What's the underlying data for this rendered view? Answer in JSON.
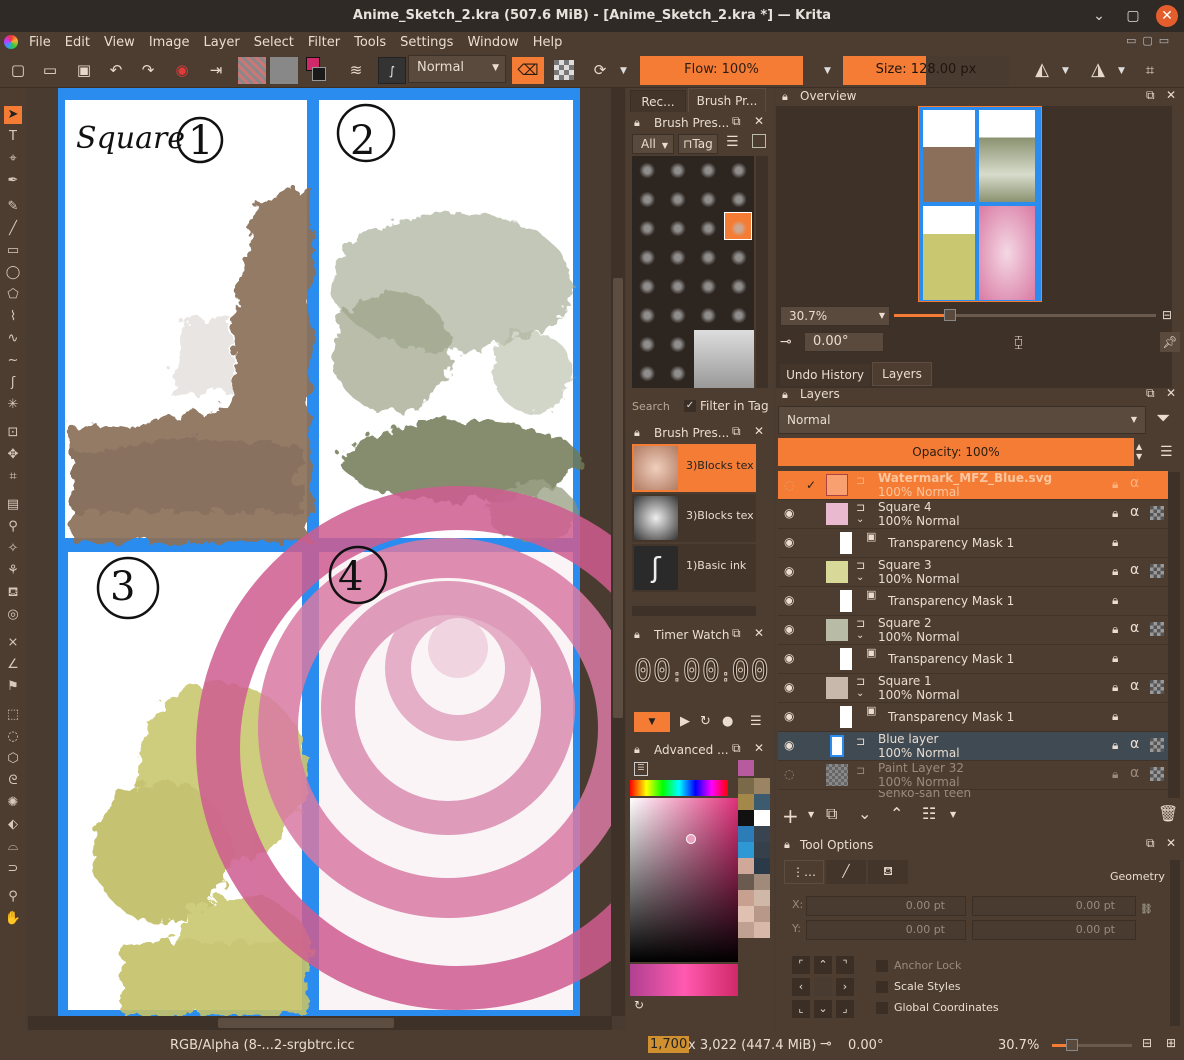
{
  "window": {
    "title": "Anime_Sketch_2.kra (507.6 MiB)  - [Anime_Sketch_2.kra *] — Krita"
  },
  "menu": [
    "File",
    "Edit",
    "View",
    "Image",
    "Layer",
    "Select",
    "Filter",
    "Tools",
    "Settings",
    "Window",
    "Help"
  ],
  "toolbar": {
    "blend_mode": "Normal",
    "flow": "Flow: 100%",
    "size": "Size: 128.00 px"
  },
  "canvas": {
    "panel1_label": "Square",
    "panel1_num": "1",
    "panel2_num": "2",
    "panel3_num": "3",
    "panel4_num": "4"
  },
  "brush_presets": {
    "tabs": [
      "Rec...",
      "Brush Pr..."
    ],
    "header": "Brush Pres...",
    "filter_all": "All",
    "tag_button": "Tag",
    "search_placeholder": "Search",
    "filter_in_tag": "Filter in Tag"
  },
  "brush_history": {
    "header": "Brush Pres...",
    "items": [
      "3)Blocks tex",
      "3)Blocks tex",
      "1)Basic ink"
    ]
  },
  "timer": {
    "header": "Timer Watch",
    "h": "00",
    "m": "00",
    "s": "00"
  },
  "color": {
    "header": "Advanced ..."
  },
  "overview": {
    "header": "Overview",
    "zoom": "30.7%",
    "rotation": "0.00°"
  },
  "layers_tabs": [
    "Undo History",
    "Layers"
  ],
  "layers": {
    "header": "Layers",
    "blend": "Normal",
    "opacity": "Opacity:  100%",
    "items": [
      {
        "name": "Watermark_MFZ_Blue.svg",
        "sub": "100% Normal"
      },
      {
        "name": "Square 4",
        "sub": "100% Normal"
      },
      {
        "name": "Transparency Mask 1",
        "sub": ""
      },
      {
        "name": "Square 3",
        "sub": "100% Normal"
      },
      {
        "name": "Transparency Mask 1",
        "sub": ""
      },
      {
        "name": "Square 2",
        "sub": "100% Normal"
      },
      {
        "name": "Transparency Mask 1",
        "sub": ""
      },
      {
        "name": "Square 1",
        "sub": "100% Normal"
      },
      {
        "name": "Transparency Mask 1",
        "sub": ""
      },
      {
        "name": "Blue layer",
        "sub": "100% Normal"
      },
      {
        "name": "Paint Layer 32",
        "sub": "100% Normal"
      },
      {
        "name": "Senko-san teen",
        "sub": ""
      }
    ]
  },
  "tool_options": {
    "header": "Tool Options",
    "geometry": "Geometry",
    "x_label": "X:",
    "y_label": "Y:",
    "x1": "0.00 pt",
    "x2": "0.00 pt",
    "y1": "0.00 pt",
    "y2": "0.00 pt",
    "anchor_lock": "Anchor Lock",
    "scale_styles": "Scale Styles",
    "global_coords": "Global Coordinates"
  },
  "status": {
    "color_profile": "RGB/Alpha (8-...2-srgbtrc.icc",
    "dimensions_w": "1,700",
    "dimensions_rest": " x 3,022 (447.4 MiB)",
    "rotation": "0.00°",
    "zoom": "30.7%"
  },
  "colors": {
    "accent": "#f47c34",
    "panel": "#4d3d31",
    "canvas_blue": "#2b8cf0",
    "brown_paint": "#8c6f5a",
    "green_paint": "#8a9270",
    "yellow_paint": "#c9c770",
    "pink_paint": "#d97aa4"
  }
}
